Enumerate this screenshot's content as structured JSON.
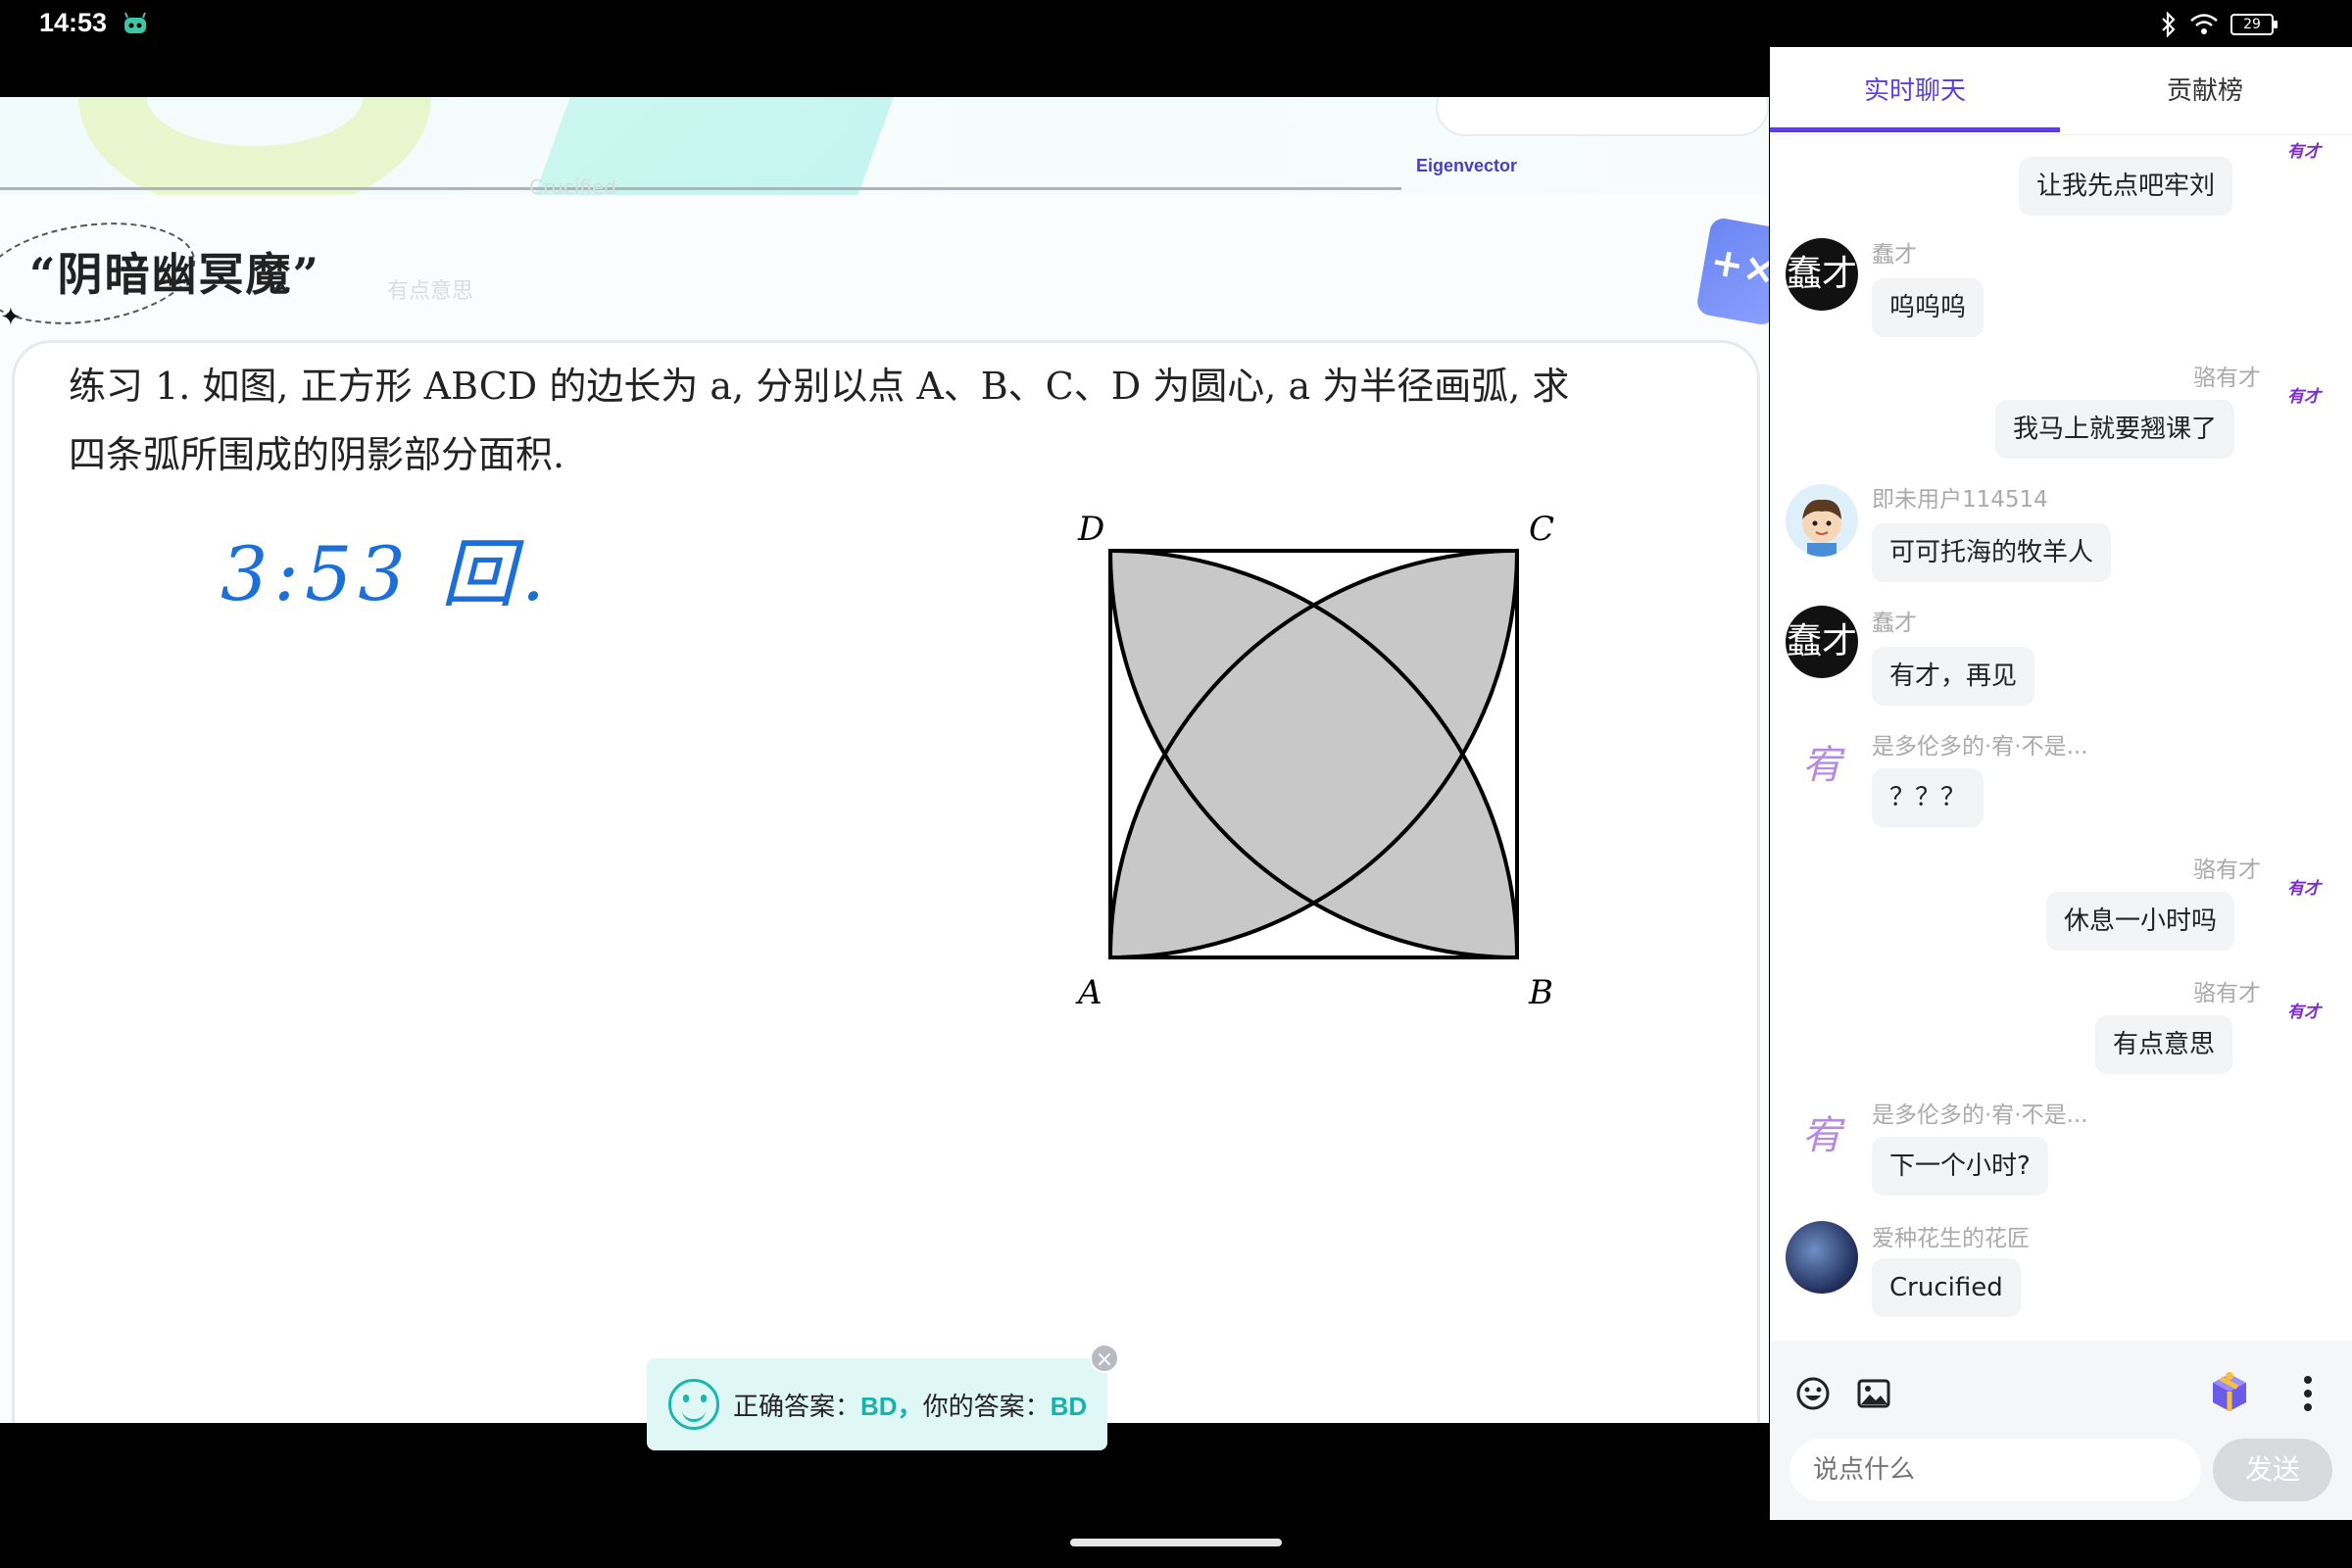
{
  "status": {
    "time": "14:53",
    "battery": "29"
  },
  "banner": {
    "brand": "Eigenvector",
    "ghost_crucified": "Crucified",
    "ghost_comment": "有点意思"
  },
  "section": {
    "title": "“阴暗幽冥魔”"
  },
  "problem": {
    "line1": "练习 1. 如图, 正方形 ABCD 的边长为 a, 分别以点 A、B、C、D 为圆心, a 为半径画弧, 求",
    "line2": "四条弧所围成的阴影部分面积."
  },
  "handwriting": "3:53 回.",
  "figure": {
    "labels": {
      "a": "A",
      "b": "B",
      "c": "C",
      "d": "D"
    }
  },
  "answer_toast": {
    "label1": "正确答案：",
    "correct": "BD，",
    "label2": "你的答案：",
    "mine": "BD"
  },
  "chat": {
    "tabs": [
      "实时聊天",
      "贡献榜"
    ],
    "badge": "有才",
    "messages": [
      {
        "side": "right",
        "name": "",
        "text": "让我先点吧牢刘"
      },
      {
        "side": "left",
        "name": "蠢才",
        "text": "呜呜呜",
        "avatar_char": "蠢才"
      },
      {
        "side": "right",
        "name": "骆有才",
        "text": "我马上就要翘课了"
      },
      {
        "side": "left",
        "name": "即未用户114514",
        "text": "可可托海的牧羊人"
      },
      {
        "side": "left",
        "name": "蠢才",
        "text": "有才，再见",
        "avatar_char": "蠢才"
      },
      {
        "side": "left",
        "name": "是多伦多的·宥·不是...",
        "text": "？？？",
        "avatar_char": "宥"
      },
      {
        "side": "right",
        "name": "骆有才",
        "text": "休息一小时吗"
      },
      {
        "side": "right",
        "name": "骆有才",
        "text": "有点意思"
      },
      {
        "side": "left",
        "name": "是多伦多的·宥·不是...",
        "text": "下一个小时?",
        "avatar_char": "宥"
      },
      {
        "side": "left",
        "name": "爱种花生的花匠",
        "text": "Crucified"
      }
    ],
    "input_placeholder": "说点什么",
    "send_label": "发送"
  }
}
